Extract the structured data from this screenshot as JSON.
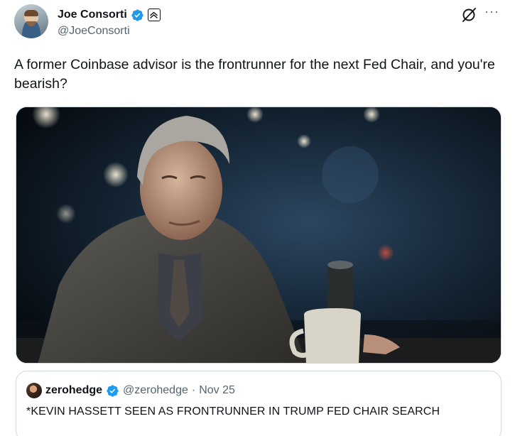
{
  "author": {
    "display_name": "Joe Consorti",
    "handle": "@JoeConsorti",
    "avatar_icon": "user-avatar-photo",
    "verified_icon": "verified-badge-icon",
    "affiliation_icon": "affiliation-badge-icon"
  },
  "actions": {
    "grok_icon": "grok-icon",
    "more_icon": "more-options-icon",
    "more_glyph": "···"
  },
  "tweet": {
    "text": "A former Coinbase advisor is the frontrunner for the next Fed Chair, and you're bearish?"
  },
  "media": {
    "image_icon": "embedded-photo"
  },
  "quote": {
    "display_name": "zerohedge",
    "handle": "@zerohedge",
    "separator": "·",
    "date": "Nov 25",
    "text": "*KEVIN HASSETT SEEN AS FRONTRUNNER IN TRUMP FED CHAIR SEARCH"
  },
  "colors": {
    "verified_blue": "#1d9bf0",
    "secondary_text": "#536471",
    "border": "#cfd9de"
  }
}
